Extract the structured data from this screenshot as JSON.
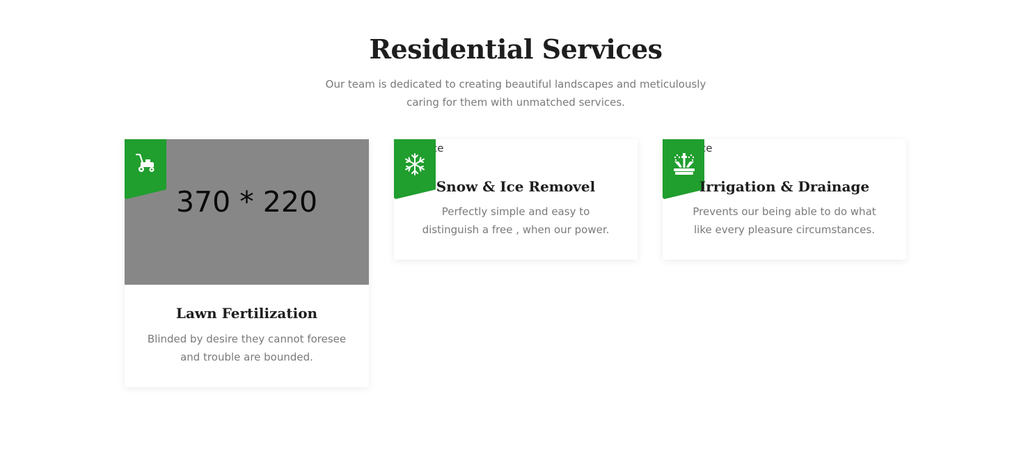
{
  "section": {
    "title": "Residential Services",
    "subtitle": "Our team is dedicated to creating beautiful landscapes and meticulously caring for them with unmatched services."
  },
  "services": [
    {
      "title": "Lawn Fertilization",
      "text": "Blinded by desire they cannot foresee and trouble are bounded.",
      "image_placeholder": "370 * 220",
      "icon": "lawn-mower-icon"
    },
    {
      "title": "Snow & Ice Removel",
      "text": "Perfectly simple and easy to distinguish a free , when our power.",
      "image_alt_fragment": "ce",
      "icon": "snowflake-icon"
    },
    {
      "title": "Irrigation & Drainage",
      "text": "Prevents our being able to do what like every pleasure circumstances.",
      "image_alt_fragment": "ce",
      "icon": "sprinkler-icon"
    }
  ],
  "colors": {
    "accent": "#209e2e",
    "heading": "#1e1e1e",
    "body_text": "#7a7a7a",
    "image_placeholder_bg": "#878787"
  }
}
